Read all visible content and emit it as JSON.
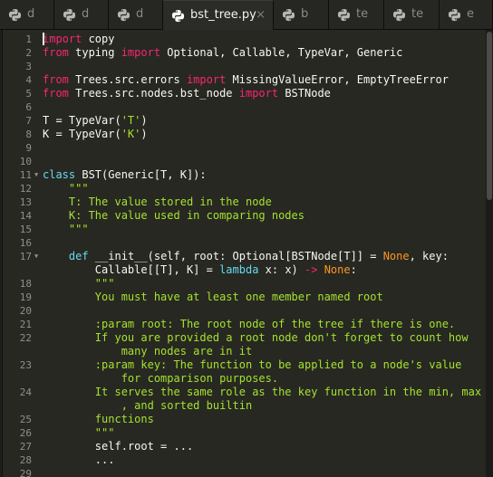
{
  "colors": {
    "keyword": "#f92672",
    "string": "#a6e22e",
    "constant": "#fd971f",
    "storage": "#66d9ef",
    "default": "#f8f8f2"
  },
  "tabs": [
    {
      "label": "d",
      "icon": "python-icon",
      "active": false
    },
    {
      "label": "d",
      "icon": "python-icon",
      "active": false
    },
    {
      "label": "d",
      "icon": "python-icon",
      "active": false
    },
    {
      "label": "bst_tree.py",
      "icon": "python-icon",
      "active": true,
      "close": "×"
    },
    {
      "label": "b",
      "icon": "python-icon",
      "active": false
    },
    {
      "label": "te",
      "icon": "python-icon",
      "active": false
    },
    {
      "label": "te",
      "icon": "python-icon",
      "active": false
    },
    {
      "label": "e",
      "icon": "python-icon",
      "active": false
    }
  ],
  "editor": {
    "lines": [
      {
        "n": "1",
        "code": [
          [
            "import",
            "k"
          ],
          [
            " copy",
            ""
          ]
        ]
      },
      {
        "n": "2",
        "code": [
          [
            "from",
            "k"
          ],
          [
            " typing ",
            ""
          ],
          [
            "import",
            "k"
          ],
          [
            " Optional, Callable, TypeVar, Generic",
            ""
          ]
        ]
      },
      {
        "n": "3",
        "code": []
      },
      {
        "n": "4",
        "code": [
          [
            "from",
            "k"
          ],
          [
            " Trees.src.errors ",
            ""
          ],
          [
            "import",
            "k"
          ],
          [
            " MissingValueError, EmptyTreeError",
            ""
          ]
        ]
      },
      {
        "n": "5",
        "code": [
          [
            "from",
            "k"
          ],
          [
            " Trees.src.nodes.bst_node ",
            ""
          ],
          [
            "import",
            "k"
          ],
          [
            " BSTNode",
            ""
          ]
        ]
      },
      {
        "n": "6",
        "code": []
      },
      {
        "n": "7",
        "code": [
          [
            "T = TypeVar(",
            ""
          ],
          [
            "'T'",
            "s"
          ],
          [
            ")",
            ""
          ]
        ]
      },
      {
        "n": "8",
        "code": [
          [
            "K = TypeVar(",
            ""
          ],
          [
            "'K'",
            "s"
          ],
          [
            ")",
            ""
          ]
        ]
      },
      {
        "n": "9",
        "code": []
      },
      {
        "n": "10",
        "code": []
      },
      {
        "n": "11",
        "fold": true,
        "code": [
          [
            "class",
            "d"
          ],
          [
            " BST(Generic[T, K]):",
            ""
          ]
        ]
      },
      {
        "n": "12",
        "code": [
          [
            "    \"\"\"",
            "s"
          ]
        ]
      },
      {
        "n": "13",
        "code": [
          [
            "    T: The value stored in the node",
            "s"
          ]
        ]
      },
      {
        "n": "14",
        "code": [
          [
            "    K: The value used in comparing nodes",
            "s"
          ]
        ]
      },
      {
        "n": "15",
        "code": [
          [
            "    \"\"\"",
            "s"
          ]
        ]
      },
      {
        "n": "16",
        "code": []
      },
      {
        "n": "17",
        "fold": true,
        "code": [
          [
            "    ",
            ""
          ],
          [
            "def",
            "d"
          ],
          [
            " __init__(self, root: Optional[BSTNode[T]] = ",
            ""
          ],
          [
            "None",
            "c"
          ],
          [
            ", key:",
            ""
          ]
        ]
      },
      {
        "n": "",
        "code": [
          [
            "        Callable[[T], K] = ",
            ""
          ],
          [
            "lambda",
            "d"
          ],
          [
            " x: x) ",
            ""
          ],
          [
            "->",
            "k"
          ],
          [
            " ",
            ""
          ],
          [
            "None",
            "c"
          ],
          [
            ":",
            ""
          ]
        ]
      },
      {
        "n": "18",
        "code": [
          [
            "        \"\"\"",
            "s"
          ]
        ]
      },
      {
        "n": "19",
        "code": [
          [
            "        You must have at least one member named root",
            "s"
          ]
        ]
      },
      {
        "n": "20",
        "code": []
      },
      {
        "n": "21",
        "code": [
          [
            "        :param root: The root node of the tree if there is one.",
            "s"
          ]
        ]
      },
      {
        "n": "22",
        "code": [
          [
            "        If you are provided a root node don't forget to count how",
            "s"
          ]
        ]
      },
      {
        "n": "",
        "code": [
          [
            "            many nodes are in it",
            "s"
          ]
        ]
      },
      {
        "n": "23",
        "code": [
          [
            "        :param key: The function to be applied to a node's value",
            "s"
          ]
        ]
      },
      {
        "n": "",
        "code": [
          [
            "            for comparison purposes.",
            "s"
          ]
        ]
      },
      {
        "n": "24",
        "code": [
          [
            "        It serves the same role as the key function in the min, max",
            "s"
          ]
        ]
      },
      {
        "n": "",
        "code": [
          [
            "            , and sorted builtin",
            "s"
          ]
        ]
      },
      {
        "n": "25",
        "code": [
          [
            "        functions",
            "s"
          ]
        ]
      },
      {
        "n": "26",
        "code": [
          [
            "        \"\"\"",
            "s"
          ]
        ]
      },
      {
        "n": "27",
        "code": [
          [
            "        self.root = ...",
            ""
          ]
        ]
      },
      {
        "n": "28",
        "code": [
          [
            "        ...",
            ""
          ]
        ]
      },
      {
        "n": "29",
        "code": []
      }
    ]
  }
}
